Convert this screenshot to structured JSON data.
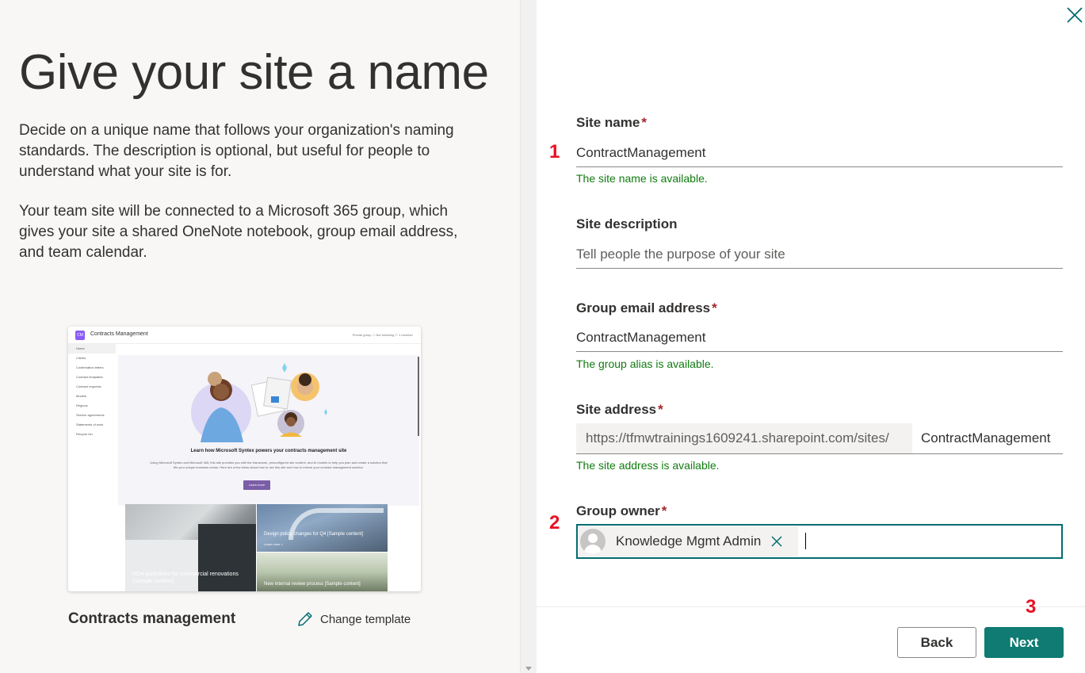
{
  "left": {
    "heading": "Give your site a name",
    "paragraph1": "Decide on a unique name that follows your organization's naming standards. The description is optional, but useful for people to understand what your site is for.",
    "paragraph2": "Your team site will be connected to a Microsoft 365 group, which gives your site a shared OneNote notebook, group email address, and team calendar.",
    "template_name": "Contracts management",
    "change_template": "Change template",
    "preview": {
      "logo": "CM",
      "site_title": "Contracts Management",
      "top_right": "Private group   ☆ Not following   ⚇ 1 member",
      "nav": [
        "Home",
        "Clients",
        "Confirmation letters",
        "Contract templates",
        "Contract requests",
        "Models",
        "Regions",
        "Service agreements",
        "Statements of work",
        "Recycle bin"
      ],
      "hero_title": "Learn how Microsoft Syntex powers your contracts management site",
      "hero_body": "Using Microsoft Syntex and Microsoft 365, this site provides you with the framework, preconfigured site content, and AI models to help you plan and create a solution that fits your unique business needs. Here are a few ideas about how to use this site and how to extend your contract management solution.",
      "learn_more": "Learn more",
      "tile1": "NDA guidelines for commercial renovations [Sample content]",
      "tile2": "Design policy changes for Q4 [Sample content]",
      "tile2_link": "Learn more  >",
      "tile3": "New internal review process [Sample content]"
    }
  },
  "form": {
    "site_name": {
      "label": "Site name",
      "required": "*",
      "value": "ContractManagement",
      "status": "The site name is available."
    },
    "site_description": {
      "label": "Site description",
      "value": "",
      "placeholder": "Tell people the purpose of your site"
    },
    "group_email": {
      "label": "Group email address",
      "required": "*",
      "value": "ContractManagement",
      "status": "The group alias is available."
    },
    "site_address": {
      "label": "Site address",
      "required": "*",
      "prefix": "https://tfmwtrainings1609241.sharepoint.com/sites/",
      "value": "ContractManagement",
      "status": "The site address is available."
    },
    "group_owner": {
      "label": "Group owner",
      "required": "*",
      "persona": "Knowledge Mgmt Admin"
    }
  },
  "markers": [
    "1",
    "2",
    "3"
  ],
  "buttons": {
    "back": "Back",
    "next": "Next"
  },
  "colors": {
    "accent": "#0f7b72",
    "success": "#107c10",
    "required": "#a4262c",
    "marker": "#e81123"
  },
  "icons": {
    "close": "close-icon",
    "edit": "pencil-icon",
    "remove": "close-icon",
    "avatar": "person-icon"
  }
}
